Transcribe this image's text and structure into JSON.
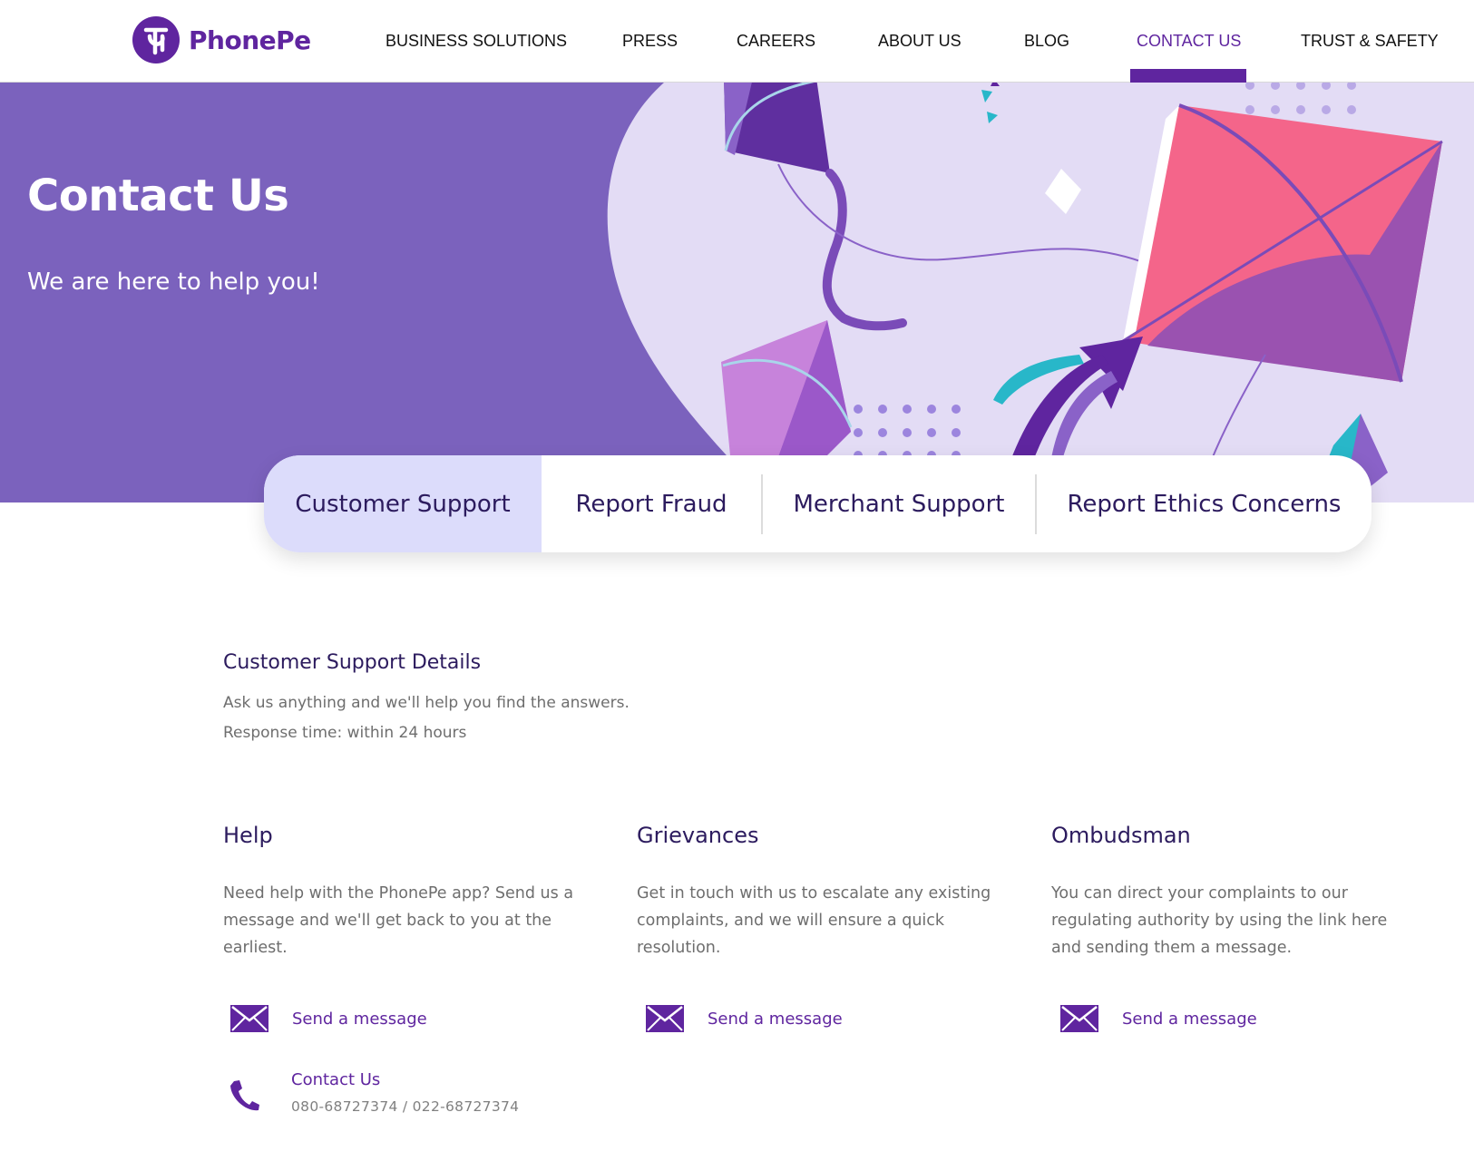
{
  "header": {
    "brand": "PhonePe",
    "nav": [
      {
        "label": "BUSINESS SOLUTIONS"
      },
      {
        "label": "PRESS"
      },
      {
        "label": "CAREERS"
      },
      {
        "label": "ABOUT US"
      },
      {
        "label": "BLOG"
      },
      {
        "label": "CONTACT US",
        "active": true
      },
      {
        "label": "TRUST & SAFETY"
      }
    ]
  },
  "hero": {
    "title": "Contact Us",
    "subtitle": "We are here to help you!"
  },
  "tabs": [
    {
      "label": "Customer Support",
      "active": true
    },
    {
      "label": "Report Fraud"
    },
    {
      "label": "Merchant Support"
    },
    {
      "label": "Report Ethics Concerns"
    }
  ],
  "details": {
    "title": "Customer Support Details",
    "line1": "Ask us anything and we'll help you find the answers.",
    "line2": "Response time: within 24 hours"
  },
  "columns": [
    {
      "title": "Help",
      "description": "Need help with the PhonePe app? Send us a message and we'll get back to you at the earliest.",
      "message_label": "Send a message"
    },
    {
      "title": "Grievances",
      "description": "Get in touch with us to escalate any existing complaints, and we will ensure a quick resolution.",
      "message_label": "Send a message"
    },
    {
      "title": "Ombudsman",
      "description": "You can direct your complaints to our regulating authority by using the link here and sending them a message.",
      "message_label": "Send a message"
    }
  ],
  "phone": {
    "label": "Contact Us",
    "numbers": "080-68727374 / 022-68727374"
  },
  "colors": {
    "brand": "#5f259f",
    "hero_bg": "#7b62bd",
    "active_tab": "#dcdcfb",
    "heading": "#2c1b5e",
    "body_text": "#6e6e6e"
  },
  "icons": {
    "logo": "phonepe-logo-icon",
    "message": "envelope-icon",
    "phone": "phone-icon"
  }
}
